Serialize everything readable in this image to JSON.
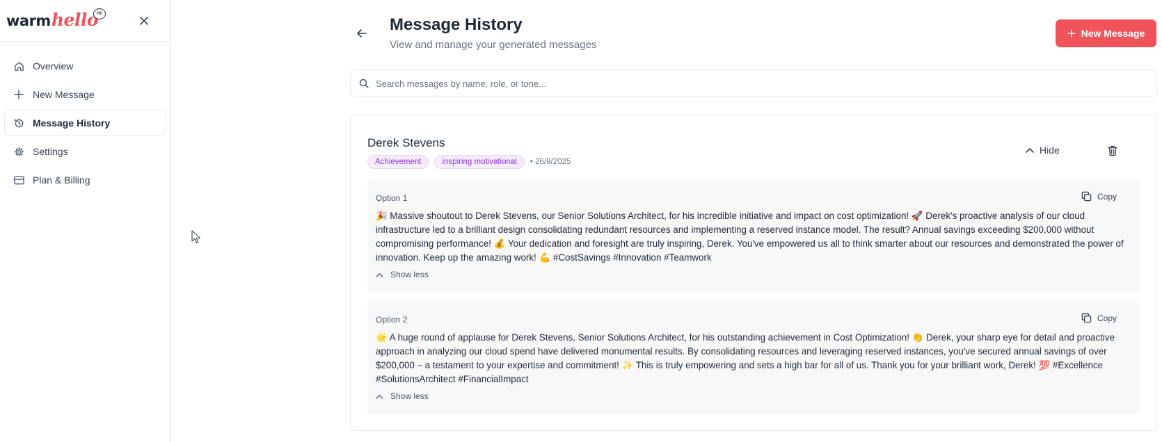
{
  "logo": {
    "warm": "warm",
    "hello": "hello",
    "bubble": "Hi!"
  },
  "sidebar": {
    "items": [
      {
        "label": "Overview",
        "icon": "home-icon"
      },
      {
        "label": "New Message",
        "icon": "plus-icon"
      },
      {
        "label": "Message History",
        "icon": "history-icon",
        "active": true
      },
      {
        "label": "Settings",
        "icon": "gear-icon"
      },
      {
        "label": "Plan & Billing",
        "icon": "credit-card-icon"
      }
    ]
  },
  "header": {
    "title": "Message History",
    "subtitle": "View and manage your generated messages",
    "new_message_label": "New Message"
  },
  "search": {
    "placeholder": "Search messages by name, role, or tone..."
  },
  "colors": {
    "accent": "#f0545a",
    "tag_text": "#9333ea",
    "tag_bg": "#f5ecfd"
  },
  "card": {
    "name": "Derek Stevens",
    "tags": [
      "Achievement",
      "inspiring motivational"
    ],
    "date": "• 26/9/2025",
    "hide_label": "Hide",
    "options": [
      {
        "label": "Option 1",
        "copy_label": "Copy",
        "text": "🎉 Massive shoutout to Derek Stevens, our Senior Solutions Architect, for his incredible initiative and impact on cost optimization! 🚀 Derek's proactive analysis of our cloud infrastructure led to a brilliant design consolidating redundant resources and implementing a reserved instance model. The result? Annual savings exceeding $200,000 without compromising performance! 💰 Your dedication and foresight are truly inspiring, Derek. You've empowered us all to think smarter about our resources and demonstrated the power of innovation. Keep up the amazing work! 💪 #CostSavings #Innovation #Teamwork",
        "show_less_label": "Show less"
      },
      {
        "label": "Option 2",
        "copy_label": "Copy",
        "text": "🌟 A huge round of applause for Derek Stevens, Senior Solutions Architect, for his outstanding achievement in Cost Optimization! 👏 Derek, your sharp eye for detail and proactive approach in analyzing our cloud spend have delivered monumental results. By consolidating resources and leveraging reserved instances, you've secured annual savings of over $200,000 – a testament to your expertise and commitment! ✨ This is truly empowering and sets a high bar for all of us. Thank you for your brilliant work, Derek! 💯 #Excellence #SolutionsArchitect #FinancialImpact",
        "show_less_label": "Show less"
      }
    ]
  }
}
